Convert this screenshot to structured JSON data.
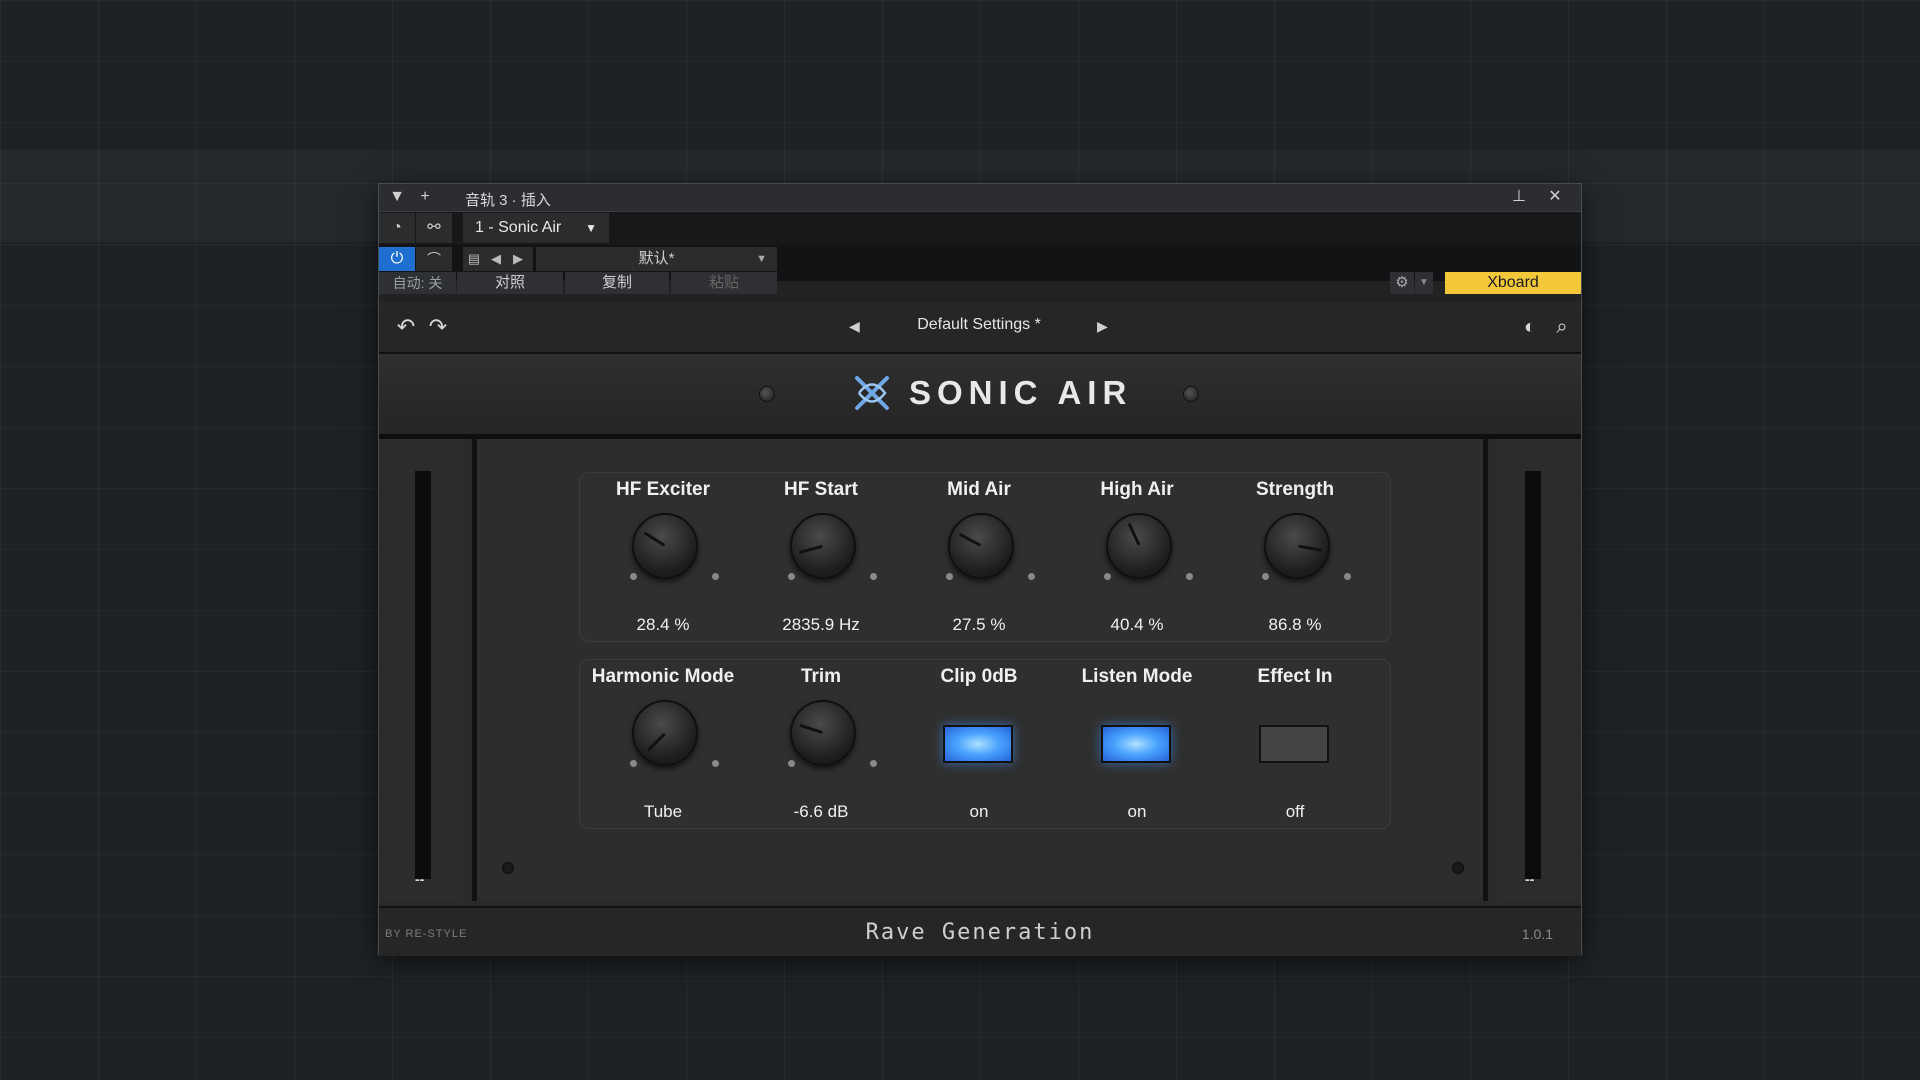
{
  "window": {
    "title": "音轨 3 · 插入",
    "plugin_selector": "1 - Sonic Air",
    "toolbar": {
      "preset_name": "默认*",
      "auto_label": "自动: 关",
      "compare_label": "对照",
      "copy_label": "复制",
      "paste_label": "粘贴",
      "xboard_label": "Xboard"
    }
  },
  "plugin": {
    "preset_display": "Default Settings *",
    "logo_text": "SONIC AIR",
    "row1": [
      {
        "label": "HF Exciter",
        "value": "28.4 %"
      },
      {
        "label": "HF Start",
        "value": "2835.9 Hz"
      },
      {
        "label": "Mid Air",
        "value": "27.5 %"
      },
      {
        "label": "High Air",
        "value": "40.4 %"
      },
      {
        "label": "Strength",
        "value": "86.8 %"
      }
    ],
    "row2": [
      {
        "label": "Harmonic Mode",
        "value": "Tube"
      },
      {
        "label": "Trim",
        "value": "-6.6 dB"
      },
      {
        "label": "Clip 0dB",
        "value": "on"
      },
      {
        "label": "Listen Mode",
        "value": "on"
      },
      {
        "label": "Effect In",
        "value": "off"
      }
    ],
    "meter_left": "--",
    "meter_right": "--",
    "footer": {
      "by": "BY RE-STYLE",
      "brand": "Rave Generation",
      "version": "1.0.1"
    }
  },
  "colors": {
    "power_accent": "#1e6fd0",
    "xboard": "#f2c83a",
    "led_on": "#4aa3ff"
  },
  "icons": [
    "chevron-down-icon",
    "plus-icon",
    "pin-icon",
    "close-icon",
    "power-icon",
    "undo-icon",
    "redo-icon",
    "search-icon",
    "gear-icon",
    "contrast-icon"
  ]
}
